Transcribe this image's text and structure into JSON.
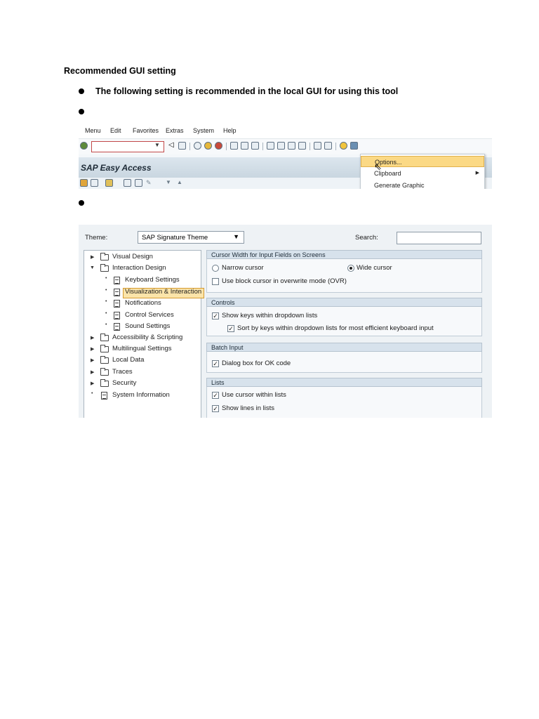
{
  "heading": "Recommended GUI setting",
  "bullets": [
    "The following setting is recommended in the local GUI for using this tool",
    "",
    ""
  ],
  "sap_menu": {
    "menubar": [
      "Menu",
      "Edit",
      "Favorites",
      "Extras",
      "System",
      "Help"
    ],
    "title": "SAP Easy Access",
    "dropdown_items": [
      "Options...",
      "Clipboard",
      "Generate Graphic"
    ],
    "selected_item": "Options..."
  },
  "options_dialog": {
    "theme_label": "Theme:",
    "theme_value": "SAP Signature Theme",
    "search_label": "Search:",
    "search_value": "",
    "tree": [
      {
        "label": "Visual Design",
        "kind": "folder",
        "expander": "right"
      },
      {
        "label": "Interaction Design",
        "kind": "folder",
        "expander": "down"
      },
      {
        "label": "Keyboard Settings",
        "kind": "doc"
      },
      {
        "label": "Visualization & Interaction",
        "kind": "doc",
        "selected": true
      },
      {
        "label": "Notifications",
        "kind": "doc"
      },
      {
        "label": "Control Services",
        "kind": "doc"
      },
      {
        "label": "Sound Settings",
        "kind": "doc"
      },
      {
        "label": "Accessibility & Scripting",
        "kind": "folder",
        "expander": "right"
      },
      {
        "label": "Multilingual Settings",
        "kind": "folder",
        "expander": "right"
      },
      {
        "label": "Local Data",
        "kind": "folder",
        "expander": "right"
      },
      {
        "label": "Traces",
        "kind": "folder",
        "expander": "right"
      },
      {
        "label": "Security",
        "kind": "folder",
        "expander": "right"
      },
      {
        "label": "System Information",
        "kind": "doc"
      }
    ],
    "sections": [
      {
        "title": "Cursor Width for Input Fields on Screens",
        "options": [
          {
            "type": "radio",
            "label": "Narrow cursor",
            "checked": false
          },
          {
            "type": "radio",
            "label": "Wide cursor",
            "checked": true
          },
          {
            "type": "checkbox",
            "label": "Use block cursor in overwrite mode (OVR)",
            "checked": false
          }
        ]
      },
      {
        "title": "Controls",
        "options": [
          {
            "type": "checkbox",
            "label": "Show keys within dropdown lists",
            "checked": true
          },
          {
            "type": "checkbox",
            "label": "Sort by keys within dropdown lists for most efficient keyboard input",
            "checked": true
          }
        ]
      },
      {
        "title": "Batch Input",
        "options": [
          {
            "type": "checkbox",
            "label": "Dialog box for OK code",
            "checked": true
          }
        ]
      },
      {
        "title": "Lists",
        "options": [
          {
            "type": "checkbox",
            "label": "Use cursor within lists",
            "checked": true
          },
          {
            "type": "checkbox",
            "label": "Show lines in lists",
            "checked": true
          }
        ]
      }
    ]
  }
}
